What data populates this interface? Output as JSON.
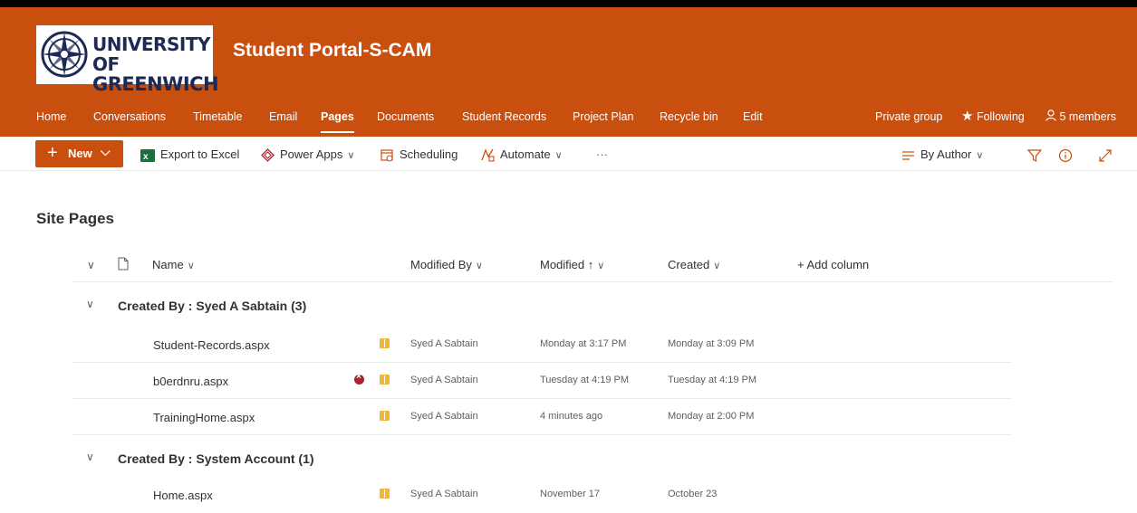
{
  "header": {
    "logo_line1": "UNIVERSITY OF",
    "logo_line2": "GREENWICH",
    "site_title": "Student Portal-S-CAM"
  },
  "nav": {
    "items": [
      "Home",
      "Conversations",
      "Timetable",
      "Email",
      "Pages",
      "Documents",
      "Student Records",
      "Project Plan",
      "Recycle bin",
      "Edit"
    ],
    "active": "Pages",
    "privacy": "Private group",
    "following": "Following",
    "members": "5 members"
  },
  "commandbar": {
    "new": "New",
    "export": "Export to Excel",
    "powerapps": "Power Apps",
    "scheduling": "Scheduling",
    "automate": "Automate",
    "more": "···",
    "view": "By Author"
  },
  "page": {
    "heading": "Site Pages"
  },
  "columns": {
    "name": "Name",
    "modified_by": "Modified By",
    "modified": "Modified ↑",
    "created": "Created",
    "add": "+ Add column"
  },
  "groups": [
    {
      "title": "Created By : Syed A Sabtain (3)",
      "rows": [
        {
          "name": "Student-Records.aspx",
          "modified_by": "Syed A Sabtain",
          "modified": "Monday at 3:17 PM",
          "created": "Monday at 3:09 PM"
        },
        {
          "name": "b0erdnru.aspx",
          "modified_by": "Syed A Sabtain",
          "modified": "Tuesday at 4:19 PM",
          "created": "Tuesday at 4:19 PM"
        },
        {
          "name": "TrainingHome.aspx",
          "modified_by": "Syed A Sabtain",
          "modified": "4 minutes ago",
          "created": "Monday at 2:00 PM"
        }
      ]
    },
    {
      "title": "Created By : System Account (1)",
      "rows": [
        {
          "name": "Home.aspx",
          "modified_by": "Syed A Sabtain",
          "modified": "November 17",
          "created": "October 23"
        }
      ]
    }
  ],
  "colors": {
    "brand": "#c94f0f",
    "error": "#a4262c",
    "page_icon": "#f2b835"
  }
}
